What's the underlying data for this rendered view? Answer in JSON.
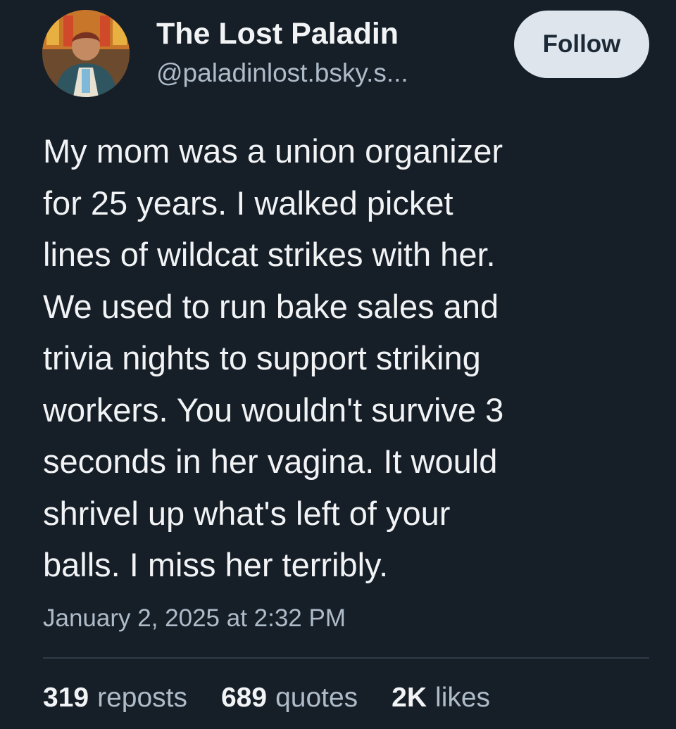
{
  "author": {
    "name": "The Lost Paladin",
    "handle": "@paladinlost.bsky.s..."
  },
  "follow_label": "Follow",
  "post": {
    "text": "My mom was a union organizer\nfor 25 years. I walked picket\nlines of wildcat strikes with her.\nWe used to run bake sales and\ntrivia nights to support striking\nworkers. You wouldn't survive 3\nseconds in her vagina. It would\nshrivel up what's left of your\nballs. I miss her terribly.",
    "timestamp": "January 2, 2025 at 2:32 PM"
  },
  "stats": {
    "reposts": {
      "count": "319",
      "label": "reposts"
    },
    "quotes": {
      "count": "689",
      "label": "quotes"
    },
    "likes": {
      "count": "2K",
      "label": "likes"
    }
  },
  "colors": {
    "background": "#161e27",
    "text_primary": "#f1f3f5",
    "text_secondary": "#aebbc9",
    "follow_button_bg": "#dfe5ec",
    "divider": "#2e3b48"
  }
}
